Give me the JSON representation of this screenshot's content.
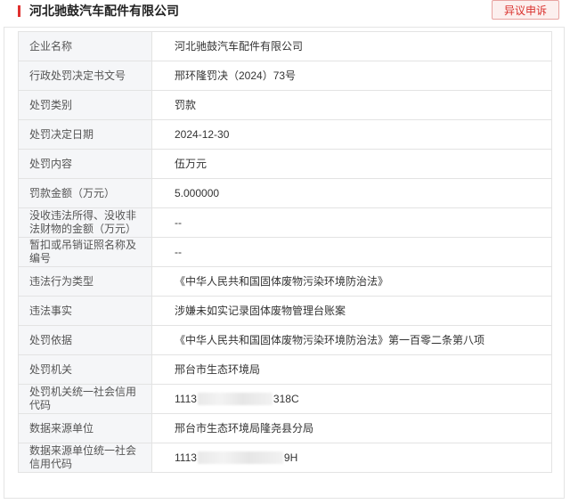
{
  "header": {
    "company_title": "河北驰鼓汽车配件有限公司",
    "objection_button": "异议申诉"
  },
  "colors": {
    "accent": "#e0312f",
    "label_bg": "#f5f6f8",
    "border": "#e3e3e3"
  },
  "rows": [
    {
      "label": "企业名称",
      "value": "河北驰鼓汽车配件有限公司"
    },
    {
      "label": "行政处罚决定书文号",
      "value": "邢环隆罚决（2024）73号"
    },
    {
      "label": "处罚类别",
      "value": "罚款"
    },
    {
      "label": "处罚决定日期",
      "value": "2024-12-30"
    },
    {
      "label": "处罚内容",
      "value": "伍万元"
    },
    {
      "label": "罚款金额（万元）",
      "value": "5.000000"
    },
    {
      "label": "没收违法所得、没收非法财物的金额（万元）",
      "value": "--"
    },
    {
      "label": "暂扣或吊销证照名称及编号",
      "value": "--"
    },
    {
      "label": "违法行为类型",
      "value": "《中华人民共和国固体废物污染环境防治法》"
    },
    {
      "label": "违法事实",
      "value": "涉嫌未如实记录固体废物管理台账案"
    },
    {
      "label": "处罚依据",
      "value": "《中华人民共和国固体废物污染环境防治法》第一百零二条第八项"
    },
    {
      "label": "处罚机关",
      "value": "邢台市生态环境局"
    },
    {
      "label": "处罚机关统一社会信用代码",
      "value_prefix": "1113",
      "value_suffix": "318C"
    },
    {
      "label": "数据来源单位",
      "value": "邢台市生态环境局隆尧县分局"
    },
    {
      "label": "数据来源单位统一社会信用代码",
      "value_prefix": "1113",
      "value_suffix": "9H"
    }
  ]
}
